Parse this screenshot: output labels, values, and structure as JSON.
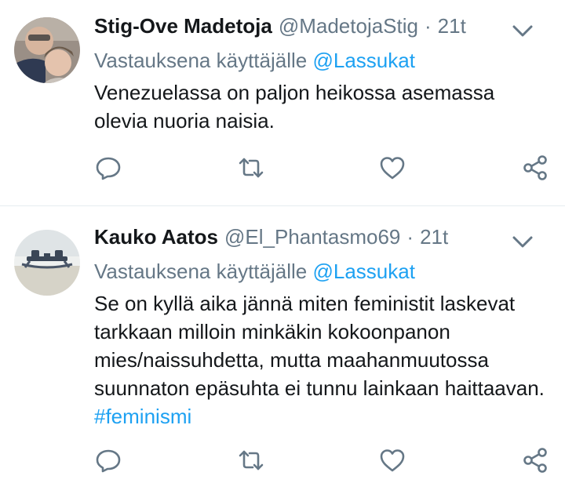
{
  "tweets": [
    {
      "name": "Stig-Ove Madetoja",
      "handle": "@MadetojaStig",
      "separator": "·",
      "time": "21t",
      "reply_prefix": "Vastauksena käyttäjälle",
      "reply_to": "@Lassukat",
      "text": "Venezuelassa on paljon heikossa asemassa olevia nuoria naisia.",
      "hashtag": ""
    },
    {
      "name": "Kauko Aatos",
      "handle": "@El_Phantasmo69",
      "separator": "·",
      "time": "21t",
      "reply_prefix": "Vastauksena käyttäjälle",
      "reply_to": "@Lassukat",
      "text": "Se on kyllä aika jännä miten feministit laskevat tarkkaan milloin minkäkin kokoonpanon mies/naissuhdetta, mutta maahanmuutossa suunnaton epäsuhta ei tunnu lainkaan haittaavan.",
      "hashtag": "#feminismi"
    }
  ],
  "icons": {
    "caret": "chevron-down-icon",
    "reply": "reply-icon",
    "retweet": "retweet-icon",
    "like": "heart-icon",
    "share": "share-icon"
  },
  "colors": {
    "icon": "#657786",
    "link": "#1da1f2",
    "text": "#14171a",
    "divider": "#e6ecf0"
  }
}
